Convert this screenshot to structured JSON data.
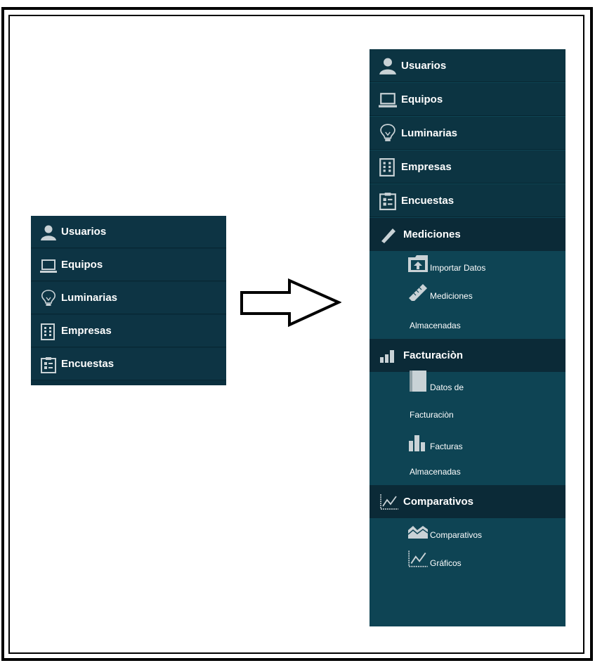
{
  "small_menu": {
    "items": [
      {
        "label": "Usuarios",
        "icon": "user-icon"
      },
      {
        "label": "Equipos",
        "icon": "laptop-icon"
      },
      {
        "label": "Luminarias",
        "icon": "lightbulb-icon"
      },
      {
        "label": "Empresas",
        "icon": "building-icon"
      },
      {
        "label": "Encuestas",
        "icon": "clipboard-icon"
      }
    ]
  },
  "arrow": {
    "icon": "right-arrow-icon"
  },
  "big_menu": {
    "items": [
      {
        "label": "Usuarios",
        "icon": "user-icon"
      },
      {
        "label": "Equipos",
        "icon": "laptop-icon"
      },
      {
        "label": "Luminarias",
        "icon": "lightbulb-icon"
      },
      {
        "label": "Empresas",
        "icon": "building-icon"
      },
      {
        "label": "Encuestas",
        "icon": "clipboard-icon"
      }
    ],
    "mediciones": {
      "label": "Mediciones",
      "icon": "ruler-icon",
      "sub": [
        {
          "line1": "Importar Datos",
          "line2": "",
          "icon": "upload-folder-icon"
        },
        {
          "line1": "Mediciones",
          "line2": "Almacenadas",
          "icon": "ruler-icon"
        }
      ]
    },
    "facturacion": {
      "label": "Facturaciòn",
      "icon": "bar-chart-icon",
      "sub": [
        {
          "line1": "Datos de",
          "line2": "Facturaciòn",
          "icon": "notebook-icon"
        },
        {
          "line1": "Facturas",
          "line2": "Almacenadas",
          "icon": "bar-chart-icon"
        }
      ]
    },
    "comparativos": {
      "label": "Comparativos",
      "icon": "line-chart-icon",
      "sub": [
        {
          "line1": "Comparativos",
          "icon": "area-chart-icon"
        },
        {
          "line1": "Gráficos",
          "icon": "line-chart-icon"
        }
      ]
    }
  },
  "colors": {
    "menu_dark": "#0c3442",
    "menu_submenu": "#0e4454",
    "text": "#ffffff",
    "icon_gray": "#c9d2d6"
  }
}
